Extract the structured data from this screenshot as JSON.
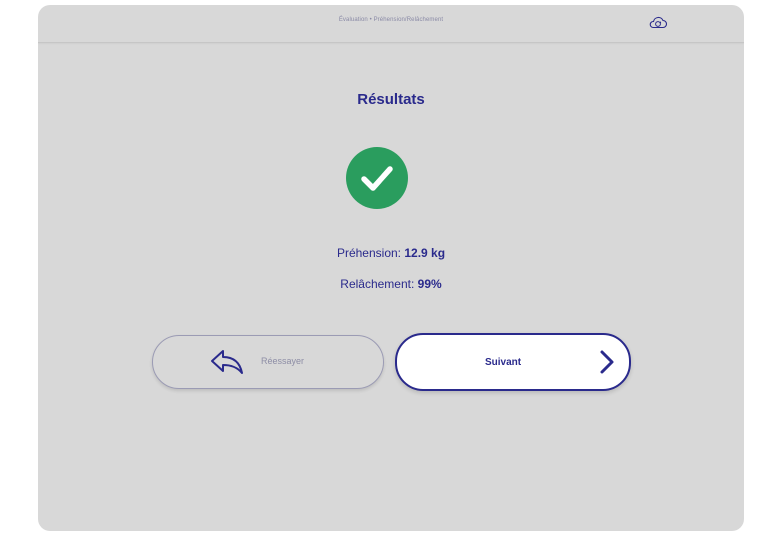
{
  "header": {
    "breadcrumb": "Évaluation • Préhension/Relâchement",
    "cloud_icon": "cloud-sync-icon"
  },
  "main": {
    "title": "Résultats",
    "status_icon": "check-circle-icon",
    "status_color": "#2a9d5e",
    "prehension_label": "Préhension:",
    "prehension_value": "12.9 kg",
    "relachement_label": "Relâchement:",
    "relachement_value": "99%"
  },
  "actions": {
    "retry_label": "Réessayer",
    "retry_icon": "undo-arrow-icon",
    "next_label": "Suivant",
    "next_icon": "chevron-right-icon"
  },
  "colors": {
    "accent": "#2a2a8c",
    "background": "#d8d8d8"
  }
}
